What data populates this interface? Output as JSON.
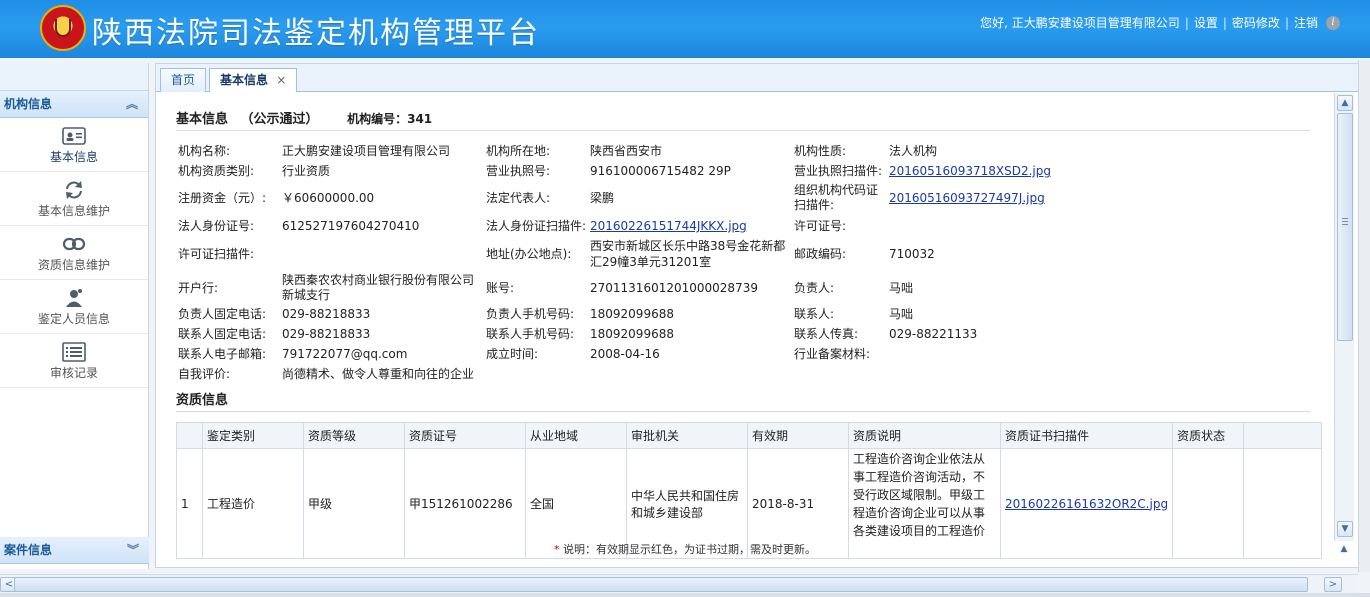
{
  "header": {
    "app_title": "陕西法院司法鉴定机构管理平台",
    "greeting": "您好, 正大鹏安建设项目管理有限公司",
    "settings_link": "设置",
    "password_link": "密码修改",
    "logout_link": "注销",
    "sep": "|"
  },
  "sidebar": {
    "top_panel": {
      "title": "机构信息",
      "chevron": "︽"
    },
    "items": [
      {
        "label": "基本信息",
        "icon": "id-card-icon"
      },
      {
        "label": "基本信息维护",
        "icon": "refresh-icon"
      },
      {
        "label": "资质信息维护",
        "icon": "link-icon"
      },
      {
        "label": "鉴定人员信息",
        "icon": "person-icon"
      },
      {
        "label": "审核记录",
        "icon": "list-icon"
      }
    ],
    "bottom_panel": {
      "title": "案件信息",
      "chevron": "︾"
    }
  },
  "tabs": [
    {
      "label": "首页"
    },
    {
      "label": "基本信息",
      "close": "×"
    }
  ],
  "basic_info": {
    "title": "基本信息",
    "status": "（公示通过）",
    "org_no_label": "机构编号：341",
    "fields": {
      "org_name_label": "机构名称:",
      "org_name": "正大鹏安建设项目管理有限公司",
      "location_label": "机构所在地:",
      "location": "陕西省西安市",
      "nature_label": "机构性质:",
      "nature": "法人机构",
      "qual_type_label": "机构资质类别:",
      "qual_type": "行业资质",
      "license_no_label": "营业执照号:",
      "license_no": "916100006715482 29P",
      "license_scan_label": "营业执照扫描件:",
      "license_scan": "20160516093718XSD2.jpg",
      "capital_label": "注册资金（元）:",
      "capital": "￥60600000.00",
      "legal_rep_label": "法定代表人:",
      "legal_rep": "梁鹏",
      "org_code_scan_label_1": "组织机构代码证",
      "org_code_scan_label_2": "扫描件:",
      "org_code_scan": "20160516093727497J.jpg",
      "legal_id_label": "法人身份证号:",
      "legal_id": "612527197604270410",
      "legal_id_scan_label": "法人身份证扫描件:",
      "legal_id_scan": "20160226151744JKKX.jpg",
      "permit_no_label": "许可证号:",
      "permit_scan_label": "许可证扫描件:",
      "address_label": "地址(办公地点):",
      "address_1": "西安市新城区长乐中路38号金花新都",
      "address_2": "汇29幢3单元31201室",
      "postcode_label": "邮政编码:",
      "postcode": "710032",
      "bank_label": "开户行:",
      "bank_1": "陕西秦农农村商业银行股份有限公司",
      "bank_2": "新城支行",
      "account_label": "账号:",
      "account": "2701131601201000028739",
      "principal_label": "负责人:",
      "principal": "马咄",
      "principal_tel_label": "负责人固定电话:",
      "principal_tel": "029-88218833",
      "principal_mobile_label": "负责人手机号码:",
      "principal_mobile": "18092099688",
      "contact_label": "联系人:",
      "contact": "马咄",
      "contact_tel_label": "联系人固定电话:",
      "contact_tel": "029-88218833",
      "contact_mobile_label": "联系人手机号码:",
      "contact_mobile": "18092099688",
      "contact_fax_label": "联系人传真:",
      "contact_fax": "029-88221133",
      "contact_email_label": "联系人电子邮箱:",
      "contact_email": "791722077@qq.com",
      "founded_label": "成立时间:",
      "founded": "2008-04-16",
      "filing_label": "行业备案材料:",
      "self_eval_label": "自我评价:",
      "self_eval": "尚德精术、做令人尊重和向往的企业"
    }
  },
  "qualification": {
    "title": "资质信息",
    "columns": [
      "",
      "鉴定类别",
      "资质等级",
      "资质证号",
      "从业地域",
      "审批机关",
      "有效期",
      "资质说明",
      "资质证书扫描件",
      "资质状态"
    ],
    "rows": [
      {
        "index": "1",
        "category": "工程造价",
        "level": "甲级",
        "cert_no": "甲151261002286",
        "region": "全国",
        "authority_1": "中华人民共和国住房",
        "authority_2": "和城乡建设部",
        "valid_until": "2018-8-31",
        "desc_1": "工程造价咨询企业依法从",
        "desc_2": "事工程造价咨询活动，不",
        "desc_3": "受行政区域限制。甲级工",
        "desc_4": "程造价咨询企业可以从事",
        "desc_5": "各类建设项目的工程造价",
        "scan": "20160226161632OR2C.jpg",
        "status": ""
      }
    ]
  },
  "note": {
    "star": "*",
    "text": "说明：有效期显示红色，为证书过期，需及时更新。"
  }
}
